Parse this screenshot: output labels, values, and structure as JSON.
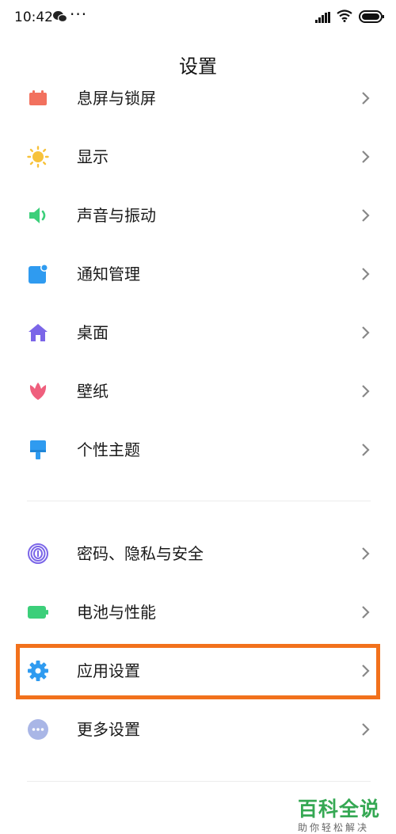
{
  "status_bar": {
    "time": "10:42",
    "dots": "···",
    "icons": [
      "wechat-icon",
      "signal-icon",
      "wifi-icon",
      "battery-icon"
    ]
  },
  "page_title": "设置",
  "settings_group_1": [
    {
      "label": "息屏与锁屏",
      "icon": "lock-screen-icon",
      "color": "#f2715e"
    },
    {
      "label": "显示",
      "icon": "sun-icon",
      "color": "#f7c23b"
    },
    {
      "label": "声音与振动",
      "icon": "speaker-icon",
      "color": "#3ccf7a"
    },
    {
      "label": "通知管理",
      "icon": "notification-icon",
      "color": "#2f9bf0"
    },
    {
      "label": "桌面",
      "icon": "home-icon",
      "color": "#7b66e8"
    },
    {
      "label": "壁纸",
      "icon": "tulip-icon",
      "color": "#ef5f7d"
    },
    {
      "label": "个性主题",
      "icon": "brush-icon",
      "color": "#2f9bf0"
    }
  ],
  "settings_group_2": [
    {
      "label": "密码、隐私与安全",
      "icon": "fingerprint-icon",
      "color": "#7b66e8"
    },
    {
      "label": "电池与性能",
      "icon": "battery-icon",
      "color": "#3ccf7a"
    },
    {
      "label": "应用设置",
      "icon": "gear-icon",
      "color": "#2f9bf0"
    },
    {
      "label": "更多设置",
      "icon": "more-icon",
      "color": "#a9b6e6"
    }
  ],
  "highlight_color": "#f2711c",
  "watermark": {
    "main": "百科全说",
    "sub": "助你轻松解决"
  }
}
